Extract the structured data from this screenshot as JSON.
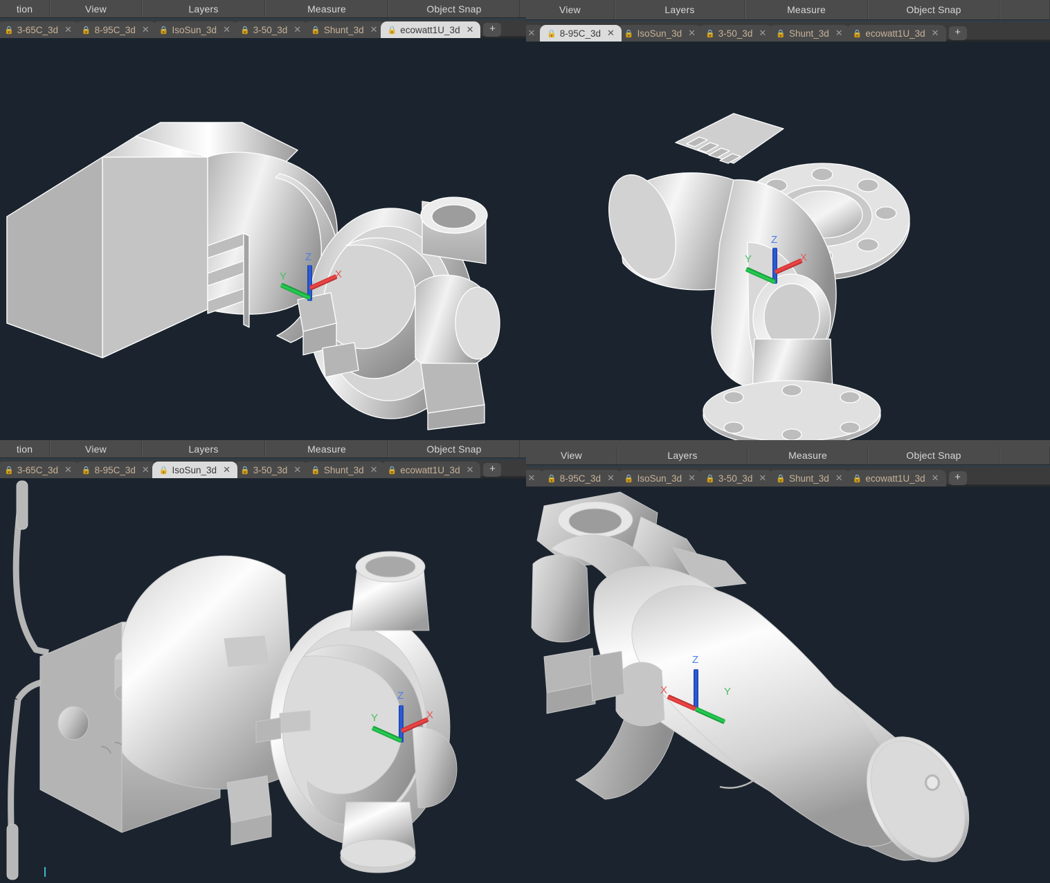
{
  "app": {
    "background_color": "#1b242e",
    "chrome_color": "#4b4b4b",
    "tab_text_color": "#c7b299",
    "active_tab_bg": "#dcdcdc"
  },
  "ribbon_tabs_left": [
    {
      "label": "tion"
    },
    {
      "label": "View"
    },
    {
      "label": "Layers"
    },
    {
      "label": "Measure"
    },
    {
      "label": "Object Snap"
    }
  ],
  "ribbon_tabs_right": [
    {
      "label": "View"
    },
    {
      "label": "Layers"
    },
    {
      "label": "Measure"
    },
    {
      "label": "Object Snap"
    }
  ],
  "document_tabs_left": [
    {
      "label": "3-65C_3d",
      "active": false
    },
    {
      "label": "8-95C_3d",
      "active": false
    },
    {
      "label": "IsoSun_3d",
      "active": false
    },
    {
      "label": "3-50_3d",
      "active": false
    },
    {
      "label": "Shunt_3d",
      "active": false
    },
    {
      "label": "ecowatt1U_3d",
      "active": true
    }
  ],
  "document_tabs_right": [
    {
      "label": "8-95C_3d",
      "active": true
    },
    {
      "label": "IsoSun_3d",
      "active": false
    },
    {
      "label": "3-50_3d",
      "active": false
    },
    {
      "label": "Shunt_3d",
      "active": false
    },
    {
      "label": "ecowatt1U_3d",
      "active": false
    }
  ],
  "document_tabs_bottom_left": [
    {
      "label": "3-65C_3d",
      "active": false
    },
    {
      "label": "8-95C_3d",
      "active": false
    },
    {
      "label": "IsoSun_3d",
      "active": true
    },
    {
      "label": "3-50_3d",
      "active": false
    },
    {
      "label": "Shunt_3d",
      "active": false
    },
    {
      "label": "ecowatt1U_3d",
      "active": false
    }
  ],
  "document_tabs_bottom_right": [
    {
      "label": "8-95C_3d",
      "active": false
    },
    {
      "label": "IsoSun_3d",
      "active": false
    },
    {
      "label": "3-50_3d",
      "active": false
    },
    {
      "label": "Shunt_3d",
      "active": false
    },
    {
      "label": "ecowatt1U_3d",
      "active": false
    }
  ],
  "icons": {
    "lock": "A",
    "close": "×",
    "add": "＋"
  },
  "panels": [
    {
      "id": "top-left",
      "active_document": "ecowatt1U_3d",
      "model_name": "circulator-pump-with-terminal-box",
      "axis_labels": {
        "x": "X",
        "y": "Y",
        "z": "Z"
      },
      "axis_orientation": "x-right y-left z-up"
    },
    {
      "id": "top-right",
      "active_document": "8-95C_3d",
      "model_name": "flanged-inline-pump",
      "axis_labels": {
        "x": "X",
        "y": "Y",
        "z": "Z"
      },
      "axis_orientation": "x-right y-left z-up"
    },
    {
      "id": "bottom-left",
      "active_document": "IsoSun_3d",
      "model_name": "volute-pump-with-capillary-tubes",
      "axis_labels": {
        "x": "X",
        "y": "Y",
        "z": "Z"
      },
      "axis_orientation": "x-right y-left z-up"
    },
    {
      "id": "bottom-right",
      "active_document": "",
      "model_name": "cylindrical-motor-body",
      "axis_labels": {
        "x": "X",
        "y": "Y",
        "z": "Z"
      },
      "axis_orientation": "x-left y-right z-up"
    }
  ]
}
